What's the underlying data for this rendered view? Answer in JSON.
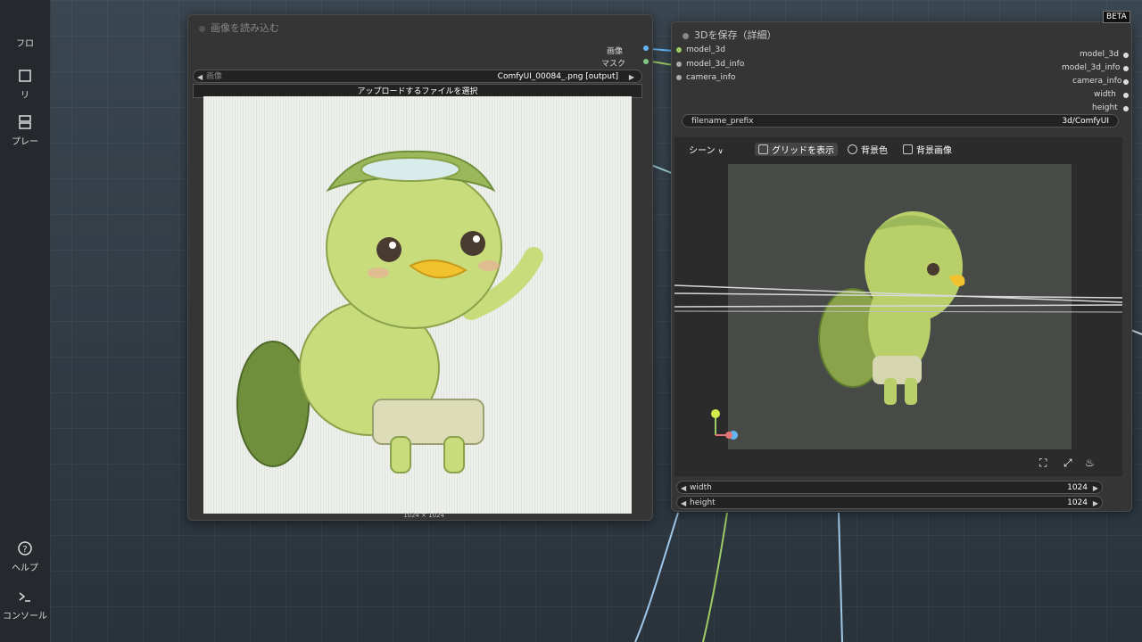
{
  "sidebar": {
    "items": [
      {
        "label": "フロ",
        "icon": "workflow-icon"
      },
      {
        "label": "リ",
        "icon": "library-icon"
      },
      {
        "label": "プレー",
        "icon": "template-icon"
      },
      {
        "label": "ヘルプ",
        "icon": "help-icon"
      },
      {
        "label": "コンソール",
        "icon": "console-icon"
      }
    ]
  },
  "load_image_node": {
    "title": "画像を読み込む",
    "outputs": [
      {
        "label": "画像",
        "color": "#64b5f6"
      },
      {
        "label": "マスク",
        "color": "#81c784"
      }
    ],
    "image_widget": {
      "label": "画像",
      "value": "ComfyUI_00084_.png [output]"
    },
    "upload_button": "アップロードするファイルを選択",
    "dimensions": "1024 × 1024"
  },
  "save3d_node": {
    "title": "3Dを保存（詳細）",
    "badge": "BETA",
    "inputs": [
      {
        "label": "model_3d",
        "color": "#9ccc65"
      },
      {
        "label": "model_3d_info",
        "color": "#aaaaaa"
      },
      {
        "label": "camera_info",
        "color": "#aaaaaa"
      }
    ],
    "outputs": [
      {
        "label": "model_3d"
      },
      {
        "label": "model_3d_info"
      },
      {
        "label": "camera_info"
      },
      {
        "label": "width"
      },
      {
        "label": "height"
      }
    ],
    "filename_prefix": {
      "label": "filename_prefix",
      "value": "3d/ComfyUI"
    },
    "toolbar": {
      "scene": "シーン",
      "show_grid": "グリッドを表示",
      "bg_color": "背景色",
      "bg_image": "背景画像"
    },
    "width_widget": {
      "label": "width",
      "value": "1024"
    },
    "height_widget": {
      "label": "height",
      "value": "1024"
    }
  },
  "colors": {
    "link_image": "#64b5f6",
    "link_mask": "#9ccc65",
    "node_bg": "#353535"
  }
}
